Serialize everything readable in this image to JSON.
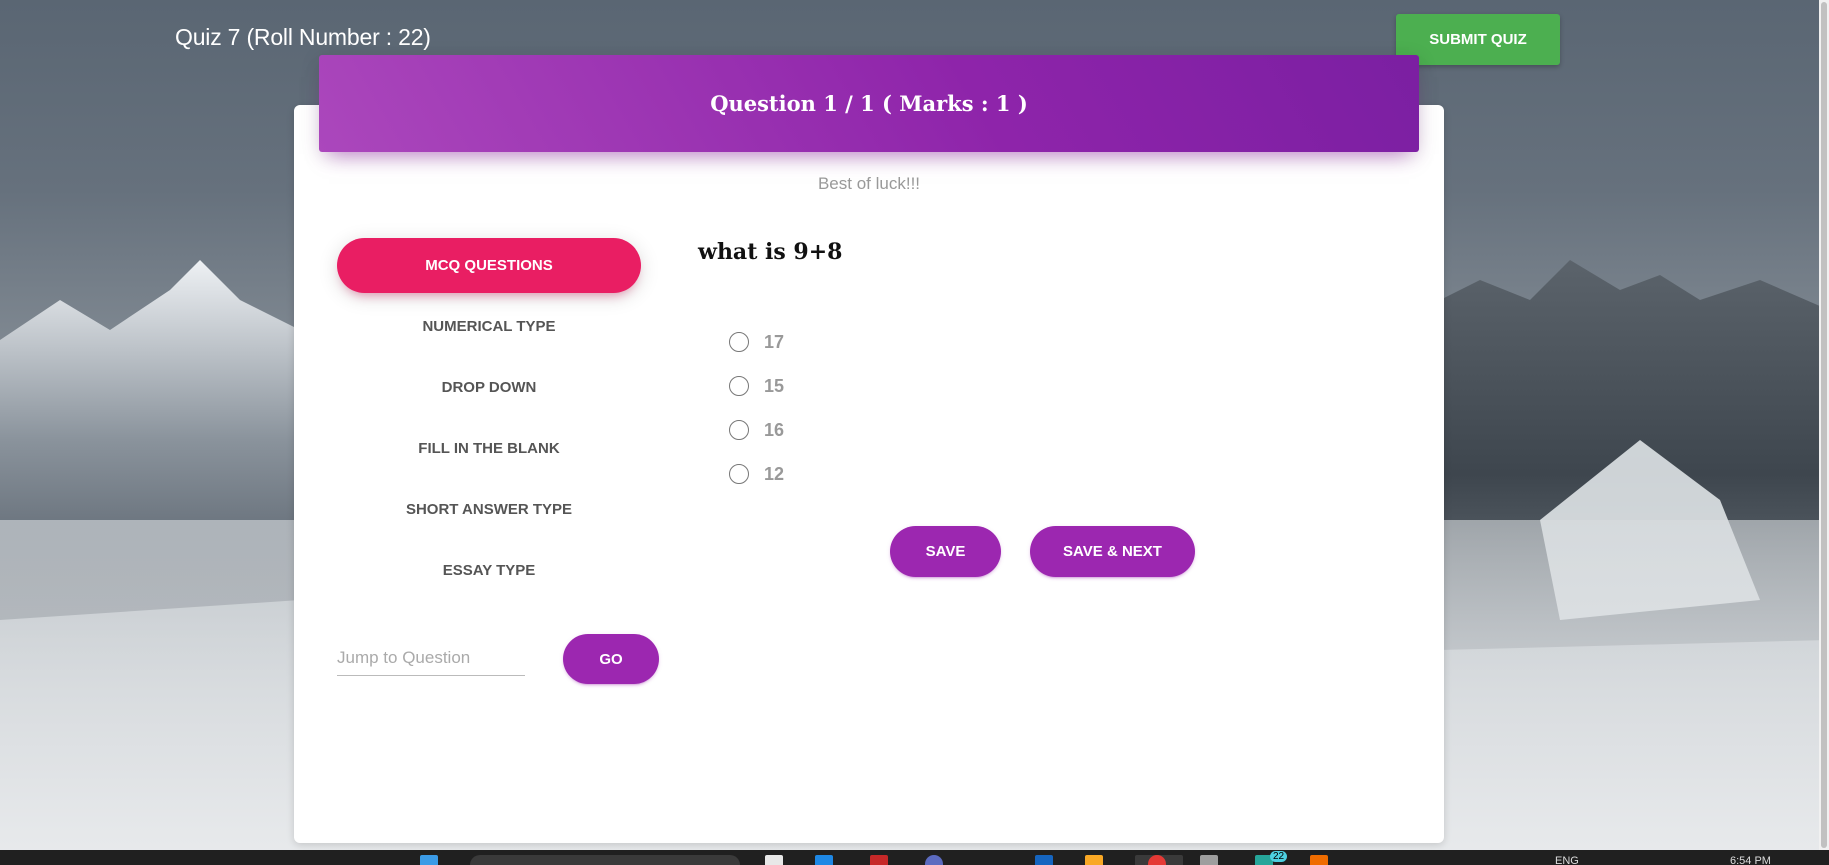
{
  "header": {
    "quiz_title": "Quiz 7 (Roll Number : 22)",
    "submit_label": "SUBMIT QUIZ"
  },
  "card": {
    "heading": "Question 1 / 1 ( Marks : 1 )",
    "subtitle": "Best of luck!!!"
  },
  "question_types": [
    {
      "label": "MCQ QUESTIONS",
      "active": true
    },
    {
      "label": "NUMERICAL TYPE",
      "active": false
    },
    {
      "label": "DROP DOWN",
      "active": false
    },
    {
      "label": "FILL IN THE BLANK",
      "active": false
    },
    {
      "label": "SHORT ANSWER TYPE",
      "active": false
    },
    {
      "label": "ESSAY TYPE",
      "active": false
    }
  ],
  "question": {
    "text": "what is 9+8",
    "options": [
      "17",
      "15",
      "16",
      "12"
    ],
    "selected": null
  },
  "actions": {
    "save_label": "SAVE",
    "save_next_label": "SAVE & NEXT"
  },
  "jump": {
    "placeholder": "Jump to Question",
    "go_label": "GO"
  },
  "colors": {
    "submit": "#4caf50",
    "header_purple": "#9c27b0",
    "active_pink": "#e91e63"
  },
  "taskbar": {
    "lang": "ENG",
    "time": "6:54 PM",
    "badge": "22"
  }
}
